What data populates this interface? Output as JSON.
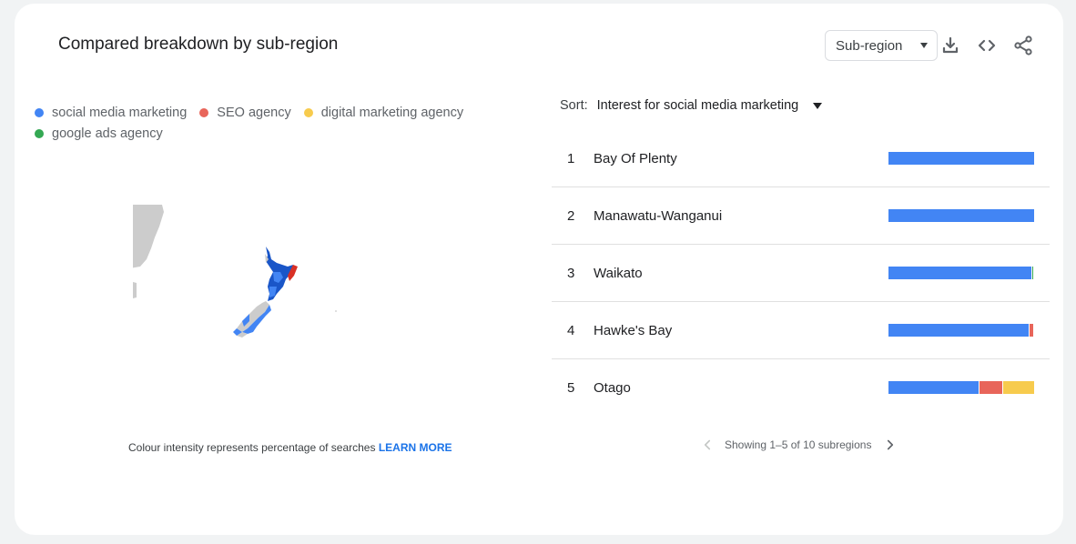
{
  "header": {
    "title": "Compared breakdown by sub-region",
    "dropdown_value": "Sub-region"
  },
  "toolbar": {
    "icons": [
      "download-icon",
      "embed-code-icon",
      "share-icon"
    ]
  },
  "legend": [
    {
      "label": "social media marketing",
      "color": "#4285f4"
    },
    {
      "label": "SEO agency",
      "color": "#e8655a"
    },
    {
      "label": "digital marketing agency",
      "color": "#f7cb4d"
    },
    {
      "label": "google ads agency",
      "color": "#34a853"
    }
  ],
  "footnote": {
    "text": "Colour intensity represents percentage of searches",
    "link": "LEARN MORE"
  },
  "sort": {
    "label": "Sort:",
    "value": "Interest for social media marketing"
  },
  "rows": [
    {
      "rank": "1",
      "name": "Bay Of Plenty",
      "shares": [
        100,
        0,
        0,
        0
      ]
    },
    {
      "rank": "2",
      "name": "Manawatu-Wanganui",
      "shares": [
        100,
        0,
        0,
        0
      ]
    },
    {
      "rank": "3",
      "name": "Waikato",
      "shares": [
        98,
        0,
        0,
        1
      ]
    },
    {
      "rank": "4",
      "name": "Hawke's Bay",
      "shares": [
        96.5,
        2.5,
        0,
        0
      ]
    },
    {
      "rank": "5",
      "name": "Otago",
      "shares": [
        62,
        16,
        21,
        0
      ]
    }
  ],
  "pagination": {
    "text": "Showing 1–5 of 10 subregions"
  }
}
